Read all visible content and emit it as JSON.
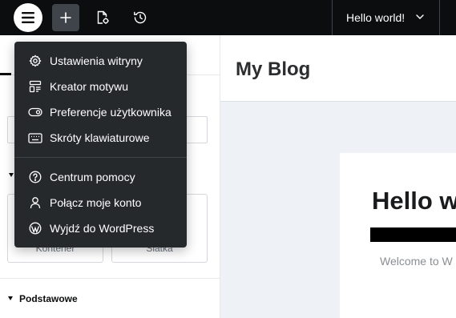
{
  "topbar": {
    "logo_icon": "elementor-menu-icon",
    "add_icon": "plus-icon",
    "page_settings_icon": "page-settings-icon",
    "history_icon": "history-icon",
    "document_title": "Hello world!",
    "document_chevron_icon": "chevron-down-icon"
  },
  "menu": {
    "group1": [
      {
        "label": "Ustawienia witryny",
        "icon": "gear-icon"
      },
      {
        "label": "Kreator motywu",
        "icon": "theme-builder-icon"
      },
      {
        "label": "Preferencje użytkownika",
        "icon": "toggle-icon"
      },
      {
        "label": "Skróty klawiaturowe",
        "icon": "keyboard-icon"
      }
    ],
    "group2": [
      {
        "label": "Centrum pomocy",
        "icon": "help-circle-icon"
      },
      {
        "label": "Połącz moje konto",
        "icon": "user-icon"
      },
      {
        "label": "Wyjdź do WordPress",
        "icon": "wordpress-icon"
      }
    ]
  },
  "panel": {
    "widgets": [
      {
        "label": "Kontener"
      },
      {
        "label": "Siatka"
      }
    ],
    "section_title": "Podstawowe"
  },
  "canvas": {
    "site_title": "My Blog",
    "post_title": "Hello w",
    "post_excerpt": "Welcome to W"
  },
  "colors": {
    "topbar_bg": "#0c0d0e",
    "menu_bg": "#26292c",
    "canvas_bg": "#eef1f6"
  }
}
